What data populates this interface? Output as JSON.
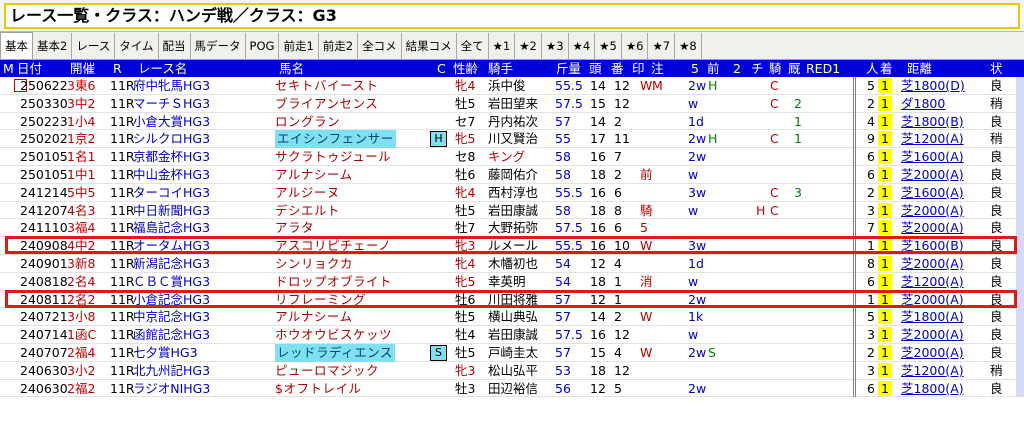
{
  "window": {
    "title": "レース一覧・クラス：ハンデ戦／クラス：G3"
  },
  "tabs": [
    {
      "label": "基本",
      "active": true
    },
    {
      "label": "基本2"
    },
    {
      "label": "レース"
    },
    {
      "label": "タイム"
    },
    {
      "label": "配当"
    },
    {
      "label": "馬データ"
    },
    {
      "label": "POG"
    },
    {
      "label": "前走1"
    },
    {
      "label": "前走2"
    },
    {
      "label": "全コメ"
    },
    {
      "label": "結果コメ"
    },
    {
      "label": "全て"
    },
    {
      "label": "★1"
    },
    {
      "label": "★2"
    },
    {
      "label": "★3"
    },
    {
      "label": "★4"
    },
    {
      "label": "★5"
    },
    {
      "label": "★6"
    },
    {
      "label": "★7"
    },
    {
      "label": "★8"
    }
  ],
  "header": {
    "m": "M",
    "date": "日付",
    "venue": "開催",
    "r": "R",
    "race": "レース名",
    "horse": "馬名",
    "c": "C",
    "sexage": "性齢",
    "jockey": "騎手",
    "weight": "斤量",
    "heads": "頭",
    "gate": "番",
    "mark": "印",
    "note": "注",
    "five": "5",
    "prev": "前",
    "two": "2",
    "chk": "チ",
    "jockey2": "騎",
    "stable": "厩",
    "red": "RED1",
    "pop": "人",
    "rank": "着",
    "distance": "距離",
    "cond": "状"
  },
  "accent_colors": {
    "header_bg": "#0000d8",
    "rank_bg": "#ffff00",
    "highlight": "#e01818",
    "horse_hl": "#7fe0f0"
  },
  "rows": [
    {
      "date": "250622",
      "venue": "3東6",
      "r": "11R",
      "race": "府中牝馬HG3",
      "horse": "セキトバイースト",
      "mark": "",
      "sex": "牝4",
      "jockey": "浜中俊",
      "wt": "55.5",
      "heads": "14",
      "gate": "12",
      "m1": "W",
      "m2": "M",
      "n1": "2w",
      "n2": "H",
      "f1": "",
      "f2": "C",
      "f3": "",
      "pop": "5",
      "rank": "1",
      "surface": "芝1800(D)",
      "cond": "良",
      "check": true
    },
    {
      "date": "250330",
      "venue": "3中2",
      "r": "11R",
      "race": "マーチＳHG3",
      "horse": "ブライアンセンス",
      "mark": "",
      "sex": "牡5",
      "jockey": "岩田望来",
      "wt": "57.5",
      "heads": "15",
      "gate": "12",
      "m1": "",
      "m2": "",
      "n1": "w",
      "n2": "",
      "f1": "",
      "f2": "C",
      "f3": "2",
      "pop": "2",
      "rank": "1",
      "surface": "ダ1800",
      "cond": "稍"
    },
    {
      "date": "250223",
      "venue": "1小4",
      "r": "11R",
      "race": "小倉大賞HG3",
      "horse": "ロングラン",
      "mark": "",
      "sex": "セ7",
      "jockey": "丹内祐次",
      "wt": "57",
      "heads": "14",
      "gate": "2",
      "m1": "",
      "m2": "",
      "n1": "1d",
      "n2": "",
      "f1": "",
      "f2": "",
      "f3": "1",
      "pop": "4",
      "rank": "1",
      "surface": "芝1800(B)",
      "cond": "良"
    },
    {
      "date": "250202",
      "venue": "1京2",
      "r": "11R",
      "race": "シルクロHG3",
      "horse": "エイシンフェンサー",
      "hl": true,
      "mark": "H",
      "sex": "牝5",
      "jockey": "川又賢治",
      "wt": "55",
      "heads": "17",
      "gate": "11",
      "m1": "",
      "m2": "",
      "n1": "2w",
      "n2": "H",
      "f1": "",
      "f2": "C",
      "f3": "1",
      "pop": "9",
      "rank": "1",
      "surface": "芝1200(A)",
      "cond": "稍"
    },
    {
      "date": "250105",
      "venue": "1名1",
      "r": "11R",
      "race": "京都金杯HG3",
      "horse": "サクラトゥジュール",
      "mark": "",
      "sex": "セ8",
      "jockey": "キング",
      "wt": "58",
      "heads": "16",
      "gate": "7",
      "m1": "",
      "m2": "",
      "n1": "2w",
      "n2": "",
      "f1": "",
      "f2": "",
      "f3": "",
      "pop": "6",
      "rank": "1",
      "surface": "芝1600(A)",
      "cond": "良",
      "jred": true
    },
    {
      "date": "250105",
      "venue": "1中1",
      "r": "11R",
      "race": "中山金杯HG3",
      "horse": "アルナシーム",
      "mark": "",
      "sex": "牡6",
      "jockey": "藤岡佑介",
      "wt": "58",
      "heads": "18",
      "gate": "2",
      "m1": "前",
      "m2": "",
      "n1": "w",
      "n2": "",
      "f1": "",
      "f2": "",
      "f3": "",
      "pop": "6",
      "rank": "1",
      "surface": "芝2000(A)",
      "cond": "良"
    },
    {
      "date": "241214",
      "venue": "5中5",
      "r": "11R",
      "race": "ターコイHG3",
      "horse": "アルジーヌ",
      "mark": "",
      "sex": "牝4",
      "jockey": "西村淳也",
      "wt": "55.5",
      "heads": "16",
      "gate": "6",
      "m1": "",
      "m2": "",
      "n1": "3w",
      "n2": "",
      "f1": "",
      "f2": "C",
      "f3": "3",
      "pop": "2",
      "rank": "1",
      "surface": "芝1600(A)",
      "cond": "良"
    },
    {
      "date": "241207",
      "venue": "4名3",
      "r": "11R",
      "race": "中日新聞HG3",
      "horse": "デシエルト",
      "mark": "",
      "sex": "牡5",
      "jockey": "岩田康誠",
      "wt": "58",
      "heads": "18",
      "gate": "8",
      "m1": "騎",
      "m2": "",
      "n1": "w",
      "n2": "",
      "f1": "H",
      "f2": "C",
      "f3": "",
      "pop": "3",
      "rank": "1",
      "surface": "芝2000(A)",
      "cond": "良"
    },
    {
      "date": "241110",
      "venue": "3福4",
      "r": "11R",
      "race": "福島記念HG3",
      "horse": "アラタ",
      "mark": "",
      "sex": "牡7",
      "jockey": "大野拓弥",
      "wt": "57.5",
      "heads": "16",
      "gate": "6",
      "m1": "5",
      "m2": "",
      "n1": "",
      "n2": "",
      "f1": "",
      "f2": "",
      "f3": "",
      "pop": "7",
      "rank": "1",
      "surface": "芝2000(A)",
      "cond": "良"
    },
    {
      "date": "240908",
      "venue": "4中2",
      "r": "11R",
      "race": "オータムHG3",
      "horse": "アスコリピチェーノ",
      "mark": "",
      "sex": "牝3",
      "jockey": "ルメール",
      "wt": "55.5",
      "heads": "16",
      "gate": "10",
      "m1": "W",
      "m2": "",
      "n1": "3w",
      "n2": "",
      "f1": "",
      "f2": "",
      "f3": "",
      "pop": "1",
      "rank": "1",
      "surface": "芝1600(B)",
      "cond": "良",
      "boxed": true
    },
    {
      "date": "240901",
      "venue": "3新8",
      "r": "11R",
      "race": "新潟記念HG3",
      "horse": "シンリョクカ",
      "mark": "",
      "sex": "牝4",
      "jockey": "木幡初也",
      "wt": "54",
      "heads": "12",
      "gate": "4",
      "m1": "",
      "m2": "",
      "n1": "1d",
      "n2": "",
      "f1": "",
      "f2": "",
      "f3": "",
      "pop": "8",
      "rank": "1",
      "surface": "芝2000(A)",
      "cond": "良"
    },
    {
      "date": "240818",
      "venue": "2名4",
      "r": "11R",
      "race": "ＣＢＣ賞HG3",
      "horse": "ドロップオブライト",
      "mark": "",
      "sex": "牝5",
      "jockey": "幸英明",
      "wt": "54",
      "heads": "18",
      "gate": "1",
      "m1": "消",
      "m2": "",
      "n1": "w",
      "n2": "",
      "f1": "",
      "f2": "",
      "f3": "",
      "pop": "6",
      "rank": "1",
      "surface": "芝1200(A)",
      "cond": "良"
    },
    {
      "date": "240811",
      "venue": "2名2",
      "r": "11R",
      "race": "小倉記念HG3",
      "horse": "リフレーミング",
      "mark": "",
      "sex": "牡6",
      "jockey": "川田将雅",
      "wt": "57",
      "heads": "12",
      "gate": "1",
      "m1": "",
      "m2": "",
      "n1": "2w",
      "n2": "",
      "f1": "",
      "f2": "",
      "f3": "",
      "pop": "1",
      "rank": "1",
      "surface": "芝2000(A)",
      "cond": "良",
      "boxed": true
    },
    {
      "date": "240721",
      "venue": "3小8",
      "r": "11R",
      "race": "中京記念HG3",
      "horse": "アルナシーム",
      "mark": "",
      "sex": "牡5",
      "jockey": "横山典弘",
      "wt": "57",
      "heads": "14",
      "gate": "2",
      "m1": "W",
      "m2": "",
      "n1": "1k",
      "n2": "",
      "f1": "",
      "f2": "",
      "f3": "",
      "pop": "5",
      "rank": "1",
      "surface": "芝1800(A)",
      "cond": "良"
    },
    {
      "date": "240714",
      "venue": "1函C",
      "r": "11R",
      "race": "函館記念HG3",
      "horse": "ホウオウビスケッツ",
      "mark": "",
      "sex": "牡4",
      "jockey": "岩田康誠",
      "wt": "57.5",
      "heads": "16",
      "gate": "12",
      "m1": "",
      "m2": "",
      "n1": "w",
      "n2": "",
      "f1": "",
      "f2": "",
      "f3": "",
      "pop": "3",
      "rank": "1",
      "surface": "芝2000(A)",
      "cond": "良"
    },
    {
      "date": "240707",
      "venue": "2福4",
      "r": "11R",
      "race": "七夕賞HG3",
      "horse": "レッドラディエンス",
      "hl": true,
      "mark": "S",
      "sex": "牡5",
      "jockey": "戸崎圭太",
      "wt": "57",
      "heads": "15",
      "gate": "4",
      "m1": "W",
      "m2": "",
      "n1": "2w",
      "n2": "S",
      "f1": "",
      "f2": "",
      "f3": "",
      "pop": "2",
      "rank": "1",
      "surface": "芝2000(A)",
      "cond": "良"
    },
    {
      "date": "240630",
      "venue": "3小2",
      "r": "11R",
      "race": "北九州記HG3",
      "horse": "ピューロマジック",
      "mark": "",
      "sex": "牝3",
      "jockey": "松山弘平",
      "wt": "53",
      "heads": "18",
      "gate": "12",
      "m1": "",
      "m2": "",
      "n1": "",
      "n2": "",
      "f1": "",
      "f2": "",
      "f3": "",
      "pop": "3",
      "rank": "1",
      "surface": "芝1200(A)",
      "cond": "稍"
    },
    {
      "date": "240630",
      "venue": "2福2",
      "r": "11R",
      "race": "ラジオNIHG3",
      "horse": "$オフトレイル",
      "mark": "",
      "sex": "牡3",
      "jockey": "田辺裕信",
      "wt": "56",
      "heads": "12",
      "gate": "5",
      "m1": "",
      "m2": "",
      "n1": "2w",
      "n2": "",
      "f1": "",
      "f2": "",
      "f3": "",
      "pop": "6",
      "rank": "1",
      "surface": "芝1800(A)",
      "cond": "良"
    }
  ]
}
